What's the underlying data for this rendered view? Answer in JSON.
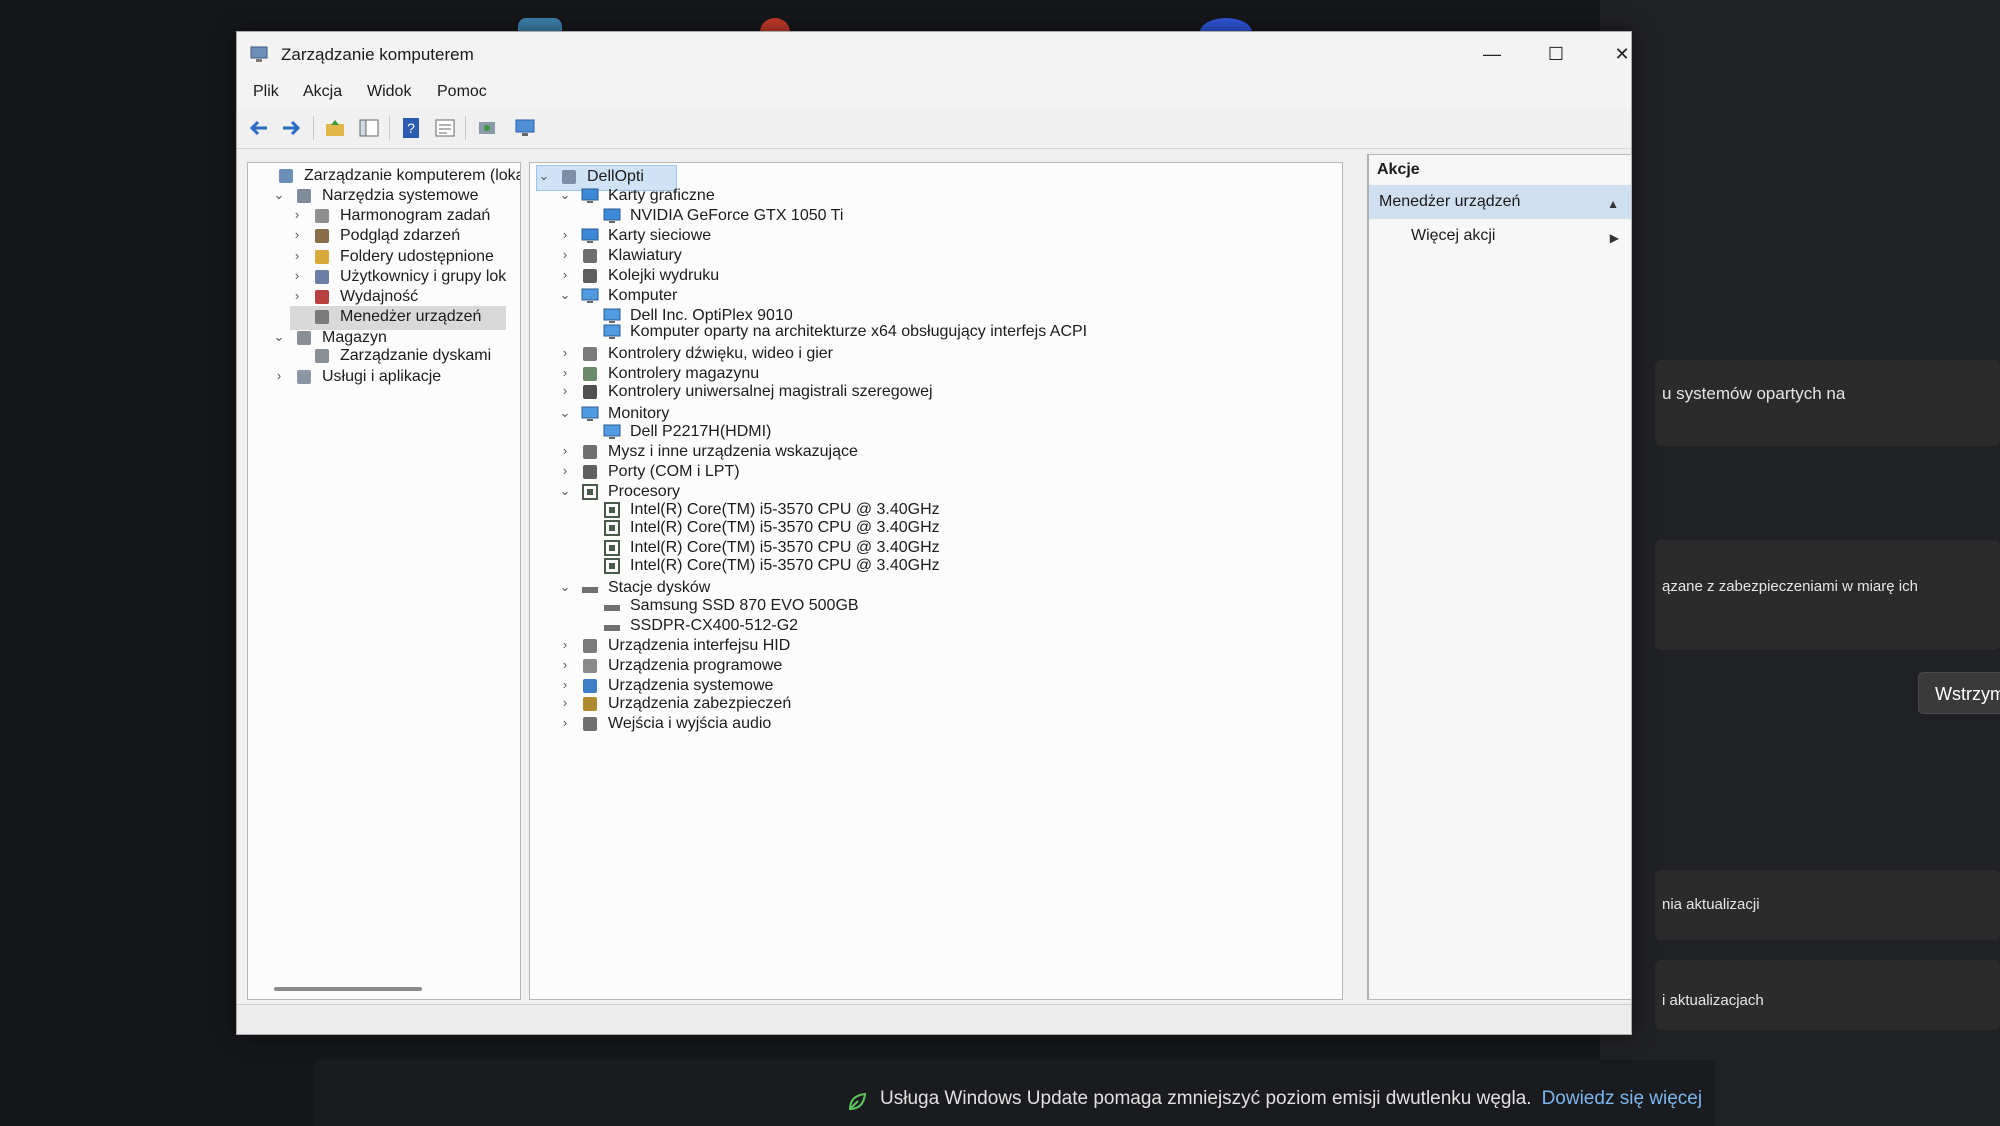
{
  "window": {
    "title": "Zarządzanie komputerem",
    "minimize": "—",
    "maximize": "☐",
    "close": "✕"
  },
  "menu": [
    "Plik",
    "Akcja",
    "Widok",
    "Pomoc"
  ],
  "toolbar": {
    "icons": [
      "back-arrow-icon",
      "forward-arrow-icon",
      "up-folder-icon",
      "console-tree-icon",
      "help-icon",
      "properties-icon",
      "refresh-icon",
      "monitor-icon"
    ]
  },
  "left_tree": [
    {
      "label": "Zarządzanie komputerem (loka",
      "arrow": "",
      "level": 0,
      "icon": "computer-management-icon"
    },
    {
      "label": "Narzędzia systemowe",
      "arrow": "⌄",
      "level": 1,
      "icon": "system-tools-icon"
    },
    {
      "label": "Harmonogram zadań",
      "arrow": "›",
      "level": 2,
      "icon": "clock-icon"
    },
    {
      "label": "Podgląd zdarzeń",
      "arrow": "›",
      "level": 2,
      "icon": "event-viewer-icon"
    },
    {
      "label": "Foldery udostępnione",
      "arrow": "›",
      "level": 2,
      "icon": "shared-folder-icon"
    },
    {
      "label": "Użytkownicy i grupy lok",
      "arrow": "›",
      "level": 2,
      "icon": "users-icon"
    },
    {
      "label": "Wydajność",
      "arrow": "›",
      "level": 2,
      "icon": "performance-icon"
    },
    {
      "label": "Menedżer urządzeń",
      "arrow": "",
      "level": 2,
      "icon": "device-manager-icon",
      "selected": true
    },
    {
      "label": "Magazyn",
      "arrow": "⌄",
      "level": 1,
      "icon": "storage-icon"
    },
    {
      "label": "Zarządzanie dyskami",
      "arrow": "",
      "level": 2,
      "icon": "disk-icon"
    },
    {
      "label": "Usługi i aplikacje",
      "arrow": "›",
      "level": 1,
      "icon": "services-icon"
    }
  ],
  "device_tree": [
    {
      "label": "DellOpti",
      "arrow": "⌄",
      "level": 0,
      "icon": "computer-icon",
      "selected": true
    },
    {
      "label": "Karty graficzne",
      "arrow": "⌄",
      "level": 1,
      "icon": "display-adapter-icon"
    },
    {
      "label": "NVIDIA GeForce GTX 1050 Ti",
      "arrow": "",
      "level": 2,
      "icon": "display-adapter-icon"
    },
    {
      "label": "Karty sieciowe",
      "arrow": "›",
      "level": 1,
      "icon": "network-adapter-icon"
    },
    {
      "label": "Klawiatury",
      "arrow": "›",
      "level": 1,
      "icon": "keyboard-icon"
    },
    {
      "label": "Kolejki wydruku",
      "arrow": "›",
      "level": 1,
      "icon": "printer-icon"
    },
    {
      "label": "Komputer",
      "arrow": "⌄",
      "level": 1,
      "icon": "monitor-icon"
    },
    {
      "label": "Dell Inc. OptiPlex 9010",
      "arrow": "",
      "level": 2,
      "icon": "monitor-icon"
    },
    {
      "label": "Komputer oparty na architekturze x64 obsługujący interfejs ACPI",
      "arrow": "",
      "level": 2,
      "icon": "monitor-icon"
    },
    {
      "label": "Kontrolery dźwięku, wideo i gier",
      "arrow": "›",
      "level": 1,
      "icon": "speaker-icon"
    },
    {
      "label": "Kontrolery magazynu",
      "arrow": "›",
      "level": 1,
      "icon": "storage-controller-icon"
    },
    {
      "label": "Kontrolery uniwersalnej magistrali szeregowej",
      "arrow": "›",
      "level": 1,
      "icon": "usb-icon"
    },
    {
      "label": "Monitory",
      "arrow": "⌄",
      "level": 1,
      "icon": "monitor-icon"
    },
    {
      "label": "Dell P2217H(HDMI)",
      "arrow": "",
      "level": 2,
      "icon": "monitor-icon"
    },
    {
      "label": "Mysz i inne urządzenia wskazujące",
      "arrow": "›",
      "level": 1,
      "icon": "mouse-icon"
    },
    {
      "label": "Porty (COM i LPT)",
      "arrow": "›",
      "level": 1,
      "icon": "port-icon"
    },
    {
      "label": "Procesory",
      "arrow": "⌄",
      "level": 1,
      "icon": "processor-icon"
    },
    {
      "label": "Intel(R) Core(TM) i5-3570 CPU @ 3.40GHz",
      "arrow": "",
      "level": 2,
      "icon": "processor-icon"
    },
    {
      "label": "Intel(R) Core(TM) i5-3570 CPU @ 3.40GHz",
      "arrow": "",
      "level": 2,
      "icon": "processor-icon"
    },
    {
      "label": "Intel(R) Core(TM) i5-3570 CPU @ 3.40GHz",
      "arrow": "",
      "level": 2,
      "icon": "processor-icon"
    },
    {
      "label": "Intel(R) Core(TM) i5-3570 CPU @ 3.40GHz",
      "arrow": "",
      "level": 2,
      "icon": "processor-icon"
    },
    {
      "label": "Stacje dysków",
      "arrow": "⌄",
      "level": 1,
      "icon": "disk-drive-icon"
    },
    {
      "label": "Samsung SSD 870 EVO 500GB",
      "arrow": "",
      "level": 2,
      "icon": "disk-drive-icon"
    },
    {
      "label": "SSDPR-CX400-512-G2",
      "arrow": "",
      "level": 2,
      "icon": "disk-drive-icon"
    },
    {
      "label": "Urządzenia interfejsu HID",
      "arrow": "›",
      "level": 1,
      "icon": "hid-icon"
    },
    {
      "label": "Urządzenia programowe",
      "arrow": "›",
      "level": 1,
      "icon": "software-device-icon"
    },
    {
      "label": "Urządzenia systemowe",
      "arrow": "›",
      "level": 1,
      "icon": "system-device-icon"
    },
    {
      "label": "Urządzenia zabezpieczeń",
      "arrow": "›",
      "level": 1,
      "icon": "security-device-icon"
    },
    {
      "label": "Wejścia i wyjścia audio",
      "arrow": "›",
      "level": 1,
      "icon": "audio-io-icon"
    }
  ],
  "actions": {
    "header": "Akcje",
    "selected": "Menedżer urządzeń",
    "more": "Więcej akcji"
  },
  "background": {
    "texts": [
      "u systemów opartych na",
      "ązane z zabezpieczeniami w miarę ich",
      "nia aktualizacji",
      "i aktualizacjach"
    ],
    "button": "Wstrzym",
    "footer_text": "Usługa Windows Update pomaga zmniejszyć poziom emisji dwutlenku węgla.",
    "footer_link": "Dowiedz się więcej"
  },
  "colors": {
    "accent": "#0067c0",
    "selection": "#cfe3f7",
    "link": "#7bb6ee"
  }
}
